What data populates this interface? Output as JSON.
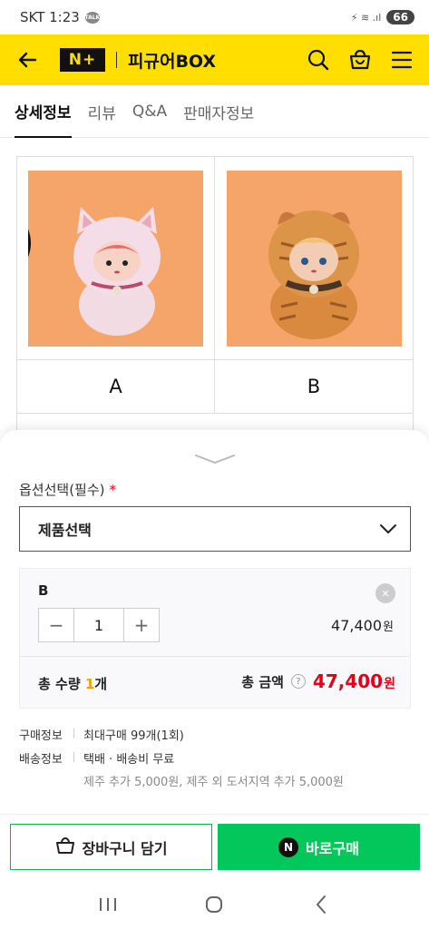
{
  "status_bar": {
    "carrier_time": "SKT 1:23",
    "talk_badge": "TALK",
    "signal": "⚡ ≋ .ıl",
    "battery": "66"
  },
  "header": {
    "logo": "N+",
    "title": "피규어BOX"
  },
  "tabs": [
    {
      "label": "상세정보",
      "active": true
    },
    {
      "label": "리뷰"
    },
    {
      "label": "Q&A"
    },
    {
      "label": "판매자정보"
    }
  ],
  "products": [
    {
      "label": "A"
    },
    {
      "label": "B"
    }
  ],
  "option_sheet": {
    "label": "옵션선택(필수)",
    "required_mark": "*",
    "select_placeholder": "제품선택",
    "selected": {
      "name": "B",
      "remove": "✕",
      "qty_minus": "−",
      "qty": "1",
      "qty_plus": "+",
      "price": "47,400",
      "price_unit": "원"
    },
    "total_qty_label": "총 수량",
    "total_qty_value": "1",
    "total_qty_unit": "개",
    "total_amount_label": "총 금액",
    "help": "?",
    "total_amount": "47,400",
    "total_amount_unit": "원"
  },
  "info": {
    "purchase_key": "구매정보",
    "purchase_val": "최대구매 99개(1회)",
    "shipping_key": "배송정보",
    "shipping_val": "택배 · 배송비 무료",
    "shipping_sub": "제주 추가 5,000원, 제주 외 도서지역 추가 5,000원"
  },
  "actions": {
    "cart_label": "장바구니 담기",
    "buy_icon_letter": "N",
    "buy_label": "바로구매"
  },
  "colors": {
    "brand_yellow": "#ffde00",
    "naver_green": "#03c75a",
    "price_red": "#e0001a",
    "qty_orange": "#f5a100",
    "product_bg": "#f6a56a"
  }
}
